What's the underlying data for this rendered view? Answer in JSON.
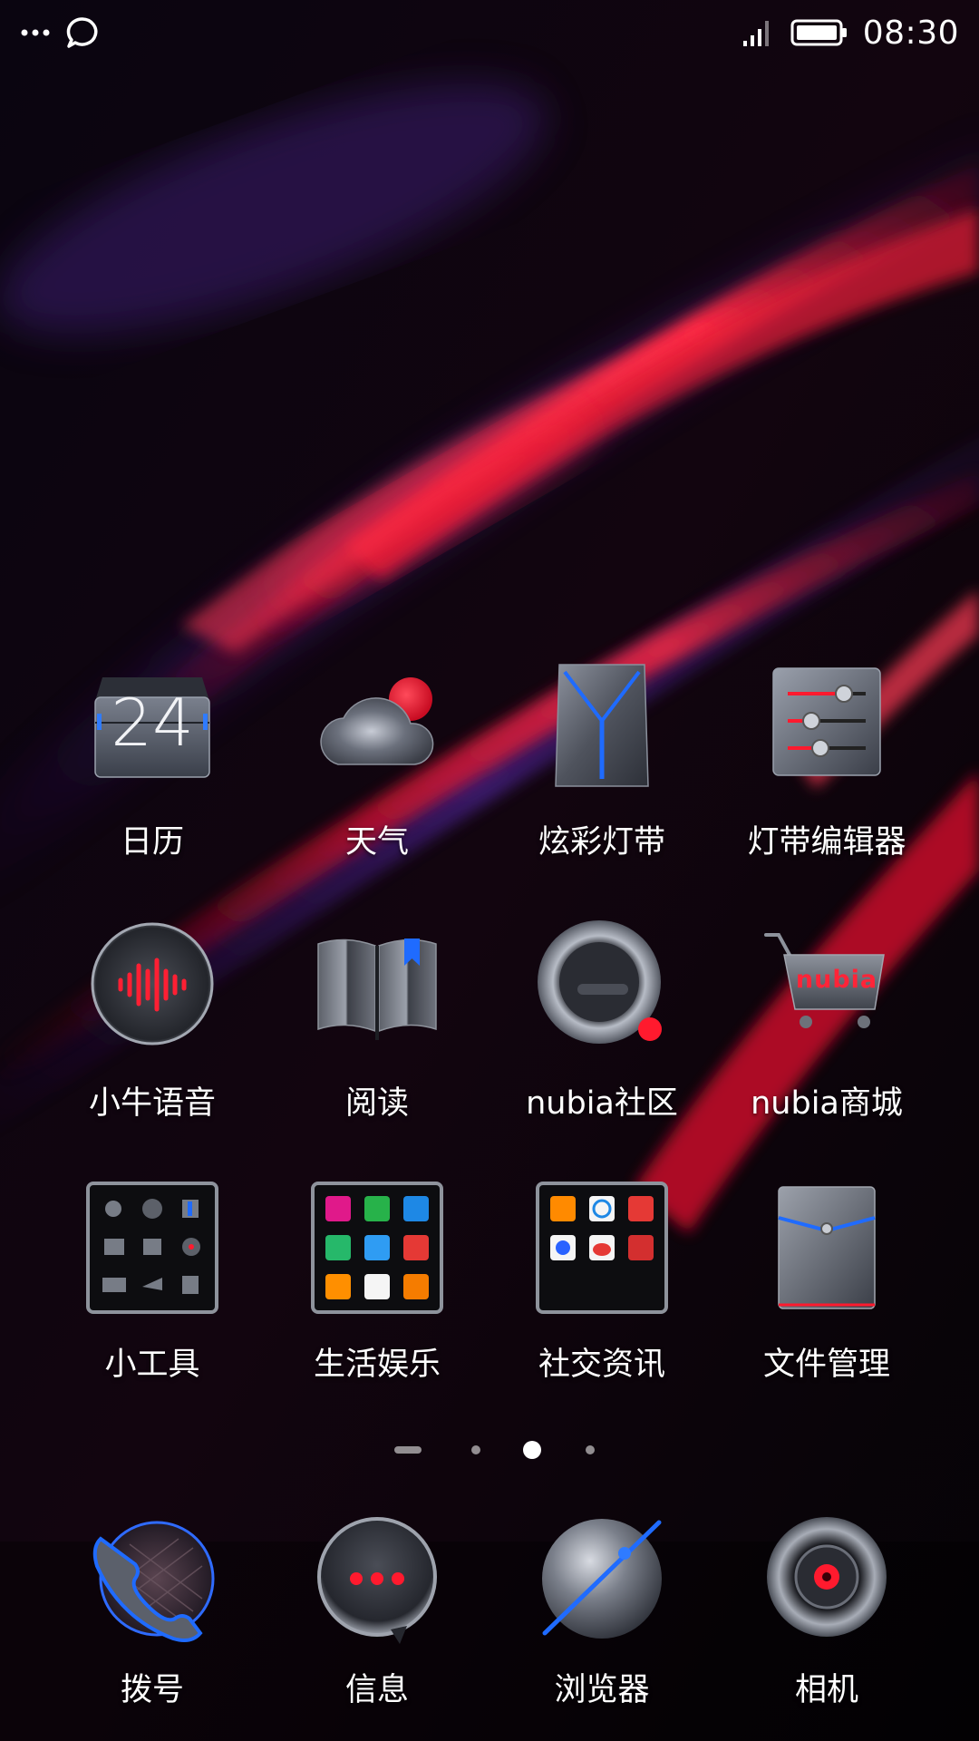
{
  "status_bar": {
    "time": "08:30",
    "left_icons": [
      "more-dots-icon",
      "chat-bubble-icon"
    ],
    "right_icons": [
      "signal-icon",
      "battery-icon"
    ]
  },
  "apps": [
    [
      {
        "label": "日历",
        "icon": "calendar-icon",
        "date": "24"
      },
      {
        "label": "天气",
        "icon": "weather-icon"
      },
      {
        "label": "炫彩灯带",
        "icon": "light-strip-icon"
      },
      {
        "label": "灯带编辑器",
        "icon": "light-editor-icon"
      }
    ],
    [
      {
        "label": "小牛语音",
        "icon": "voice-assistant-icon"
      },
      {
        "label": "阅读",
        "icon": "reading-book-icon"
      },
      {
        "label": "nubia社区",
        "icon": "community-icon"
      },
      {
        "label": "nubia商城",
        "icon": "store-cart-icon",
        "brand": "nubia"
      }
    ],
    [
      {
        "label": "小工具",
        "icon": "folder-tools-icon"
      },
      {
        "label": "生活娱乐",
        "icon": "folder-life-icon"
      },
      {
        "label": "社交资讯",
        "icon": "folder-social-icon"
      },
      {
        "label": "文件管理",
        "icon": "file-manager-icon"
      }
    ]
  ],
  "page_indicator": {
    "pages": 4,
    "current": 3
  },
  "dock": [
    {
      "label": "拨号",
      "icon": "phone-icon"
    },
    {
      "label": "信息",
      "icon": "messages-icon"
    },
    {
      "label": "浏览器",
      "icon": "browser-icon"
    },
    {
      "label": "相机",
      "icon": "camera-icon"
    }
  ],
  "colors": {
    "accent_red": "#e0142c",
    "accent_blue": "#1f6bff",
    "metal": "#8a8f9c"
  }
}
